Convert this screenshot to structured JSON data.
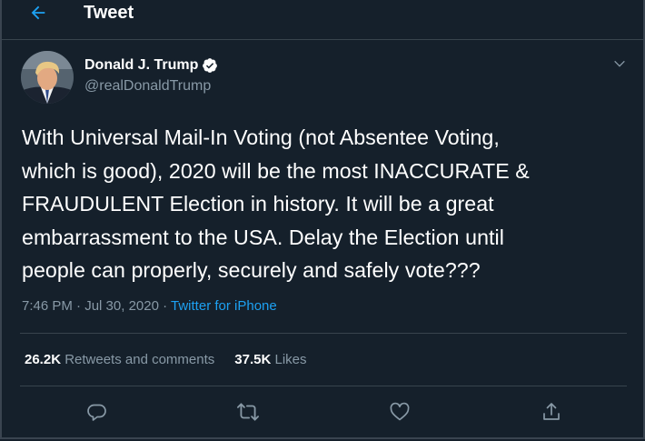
{
  "header": {
    "title": "Tweet",
    "back_icon": "arrow-left-icon"
  },
  "author": {
    "display_name": "Donald J. Trump",
    "handle": "@realDonaldTrump",
    "verified_icon": "verified-badge-icon"
  },
  "tweet": {
    "lines": [
      "With Universal Mail-In Voting (not Absentee Voting,",
      "which is good), 2020 will be the most INACCURATE &",
      "FRAUDULENT Election in history. It will be a great",
      "embarrassment to the USA. Delay the Election until",
      "people can properly, securely and safely vote???"
    ],
    "time": "7:46 PM",
    "separator": " · ",
    "date": "Jul 30, 2020",
    "source": "Twitter for iPhone"
  },
  "stats": {
    "retweets_count": "26.2K",
    "retweets_label": " Retweets and comments",
    "likes_count": "37.5K",
    "likes_label": " Likes"
  },
  "actions": [
    "reply-icon",
    "retweet-icon",
    "like-icon",
    "share-icon"
  ],
  "colors": {
    "background": "#15202b",
    "accent": "#1da1f2",
    "muted": "#8899a6",
    "border": "#38444d"
  }
}
